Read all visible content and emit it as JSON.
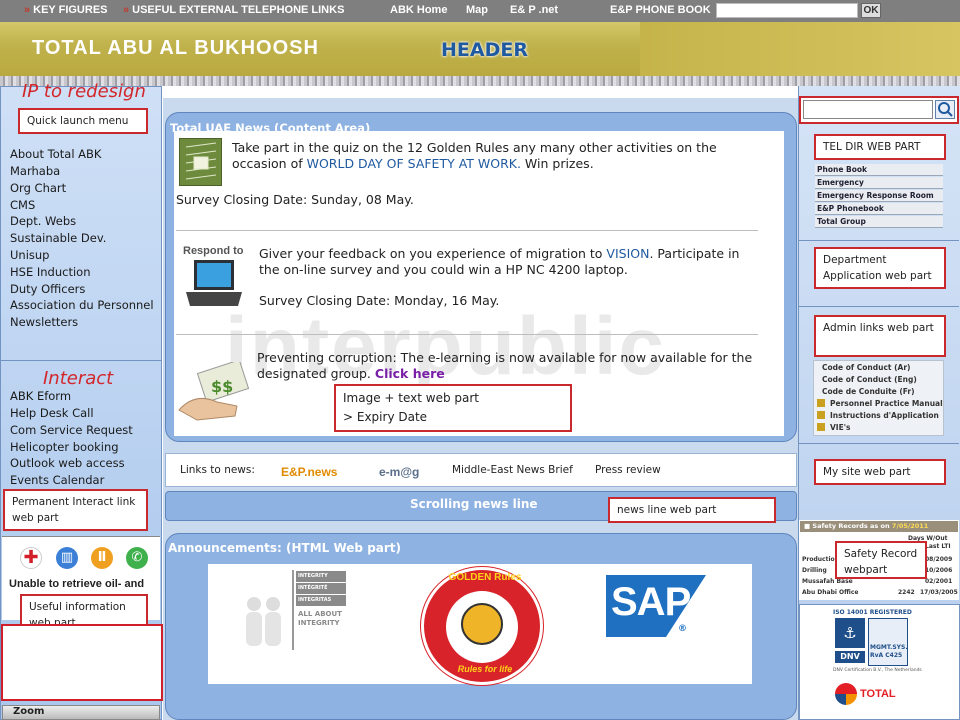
{
  "topnav": {
    "items": [
      "KEY FIGURES",
      "USEFUL EXTERNAL TELEPHONE LINKS",
      "ABK Home",
      "Map",
      "E& P .net",
      "E&P PHONE BOOK"
    ],
    "ok_label": "OK"
  },
  "header": {
    "brand": "TOTAL ABU AL BUKHOOSH",
    "label": "HEADER"
  },
  "annotations": {
    "ip_redesign": "IP to redesign",
    "quick_launch": "Quick launch menu",
    "interact_title": "Interact",
    "permanent_interact": "Permanent Interact link web part",
    "useful_info": "Useful information web part",
    "image_text": [
      "Image + text web part",
      "> Expiry Date"
    ],
    "news_line": "news line web part",
    "tel_dir": "TEL DIR WEB PART",
    "dept_app": "Department Application web part",
    "admin_links": "Admin links web part",
    "my_site": "My site web part",
    "safety_record": "Safety Record webpart"
  },
  "left_menu": {
    "quick_links": [
      "About Total ABK",
      "Marhaba",
      "Org Chart",
      "CMS",
      "Dept. Webs",
      "Sustainable Dev.",
      "Unisup",
      "HSE Induction",
      "Duty Officers",
      "Association du Personnel",
      "Newsletters"
    ],
    "interact_links": [
      "ABK Eform",
      "Help Desk Call",
      "Com Service Request",
      "Helicopter booking",
      "Outlook web access",
      "Events Calendar"
    ],
    "unable_text": "Unable to retrieve oil- and",
    "zoom": "Zoom"
  },
  "news": {
    "title": "Total UAE News (Content Area)",
    "item1": {
      "text_a": "Take part in the quiz on the 12 Golden Rules any many other activities on the occasion of ",
      "link": "WORLD DAY OF SAFETY AT WORK.",
      "text_b": " Win prizes.",
      "closing": "Survey Closing Date: Sunday, 08 May."
    },
    "item2": {
      "respond": "Respond to",
      "text_a": "Giver your feedback on you experience of migration to ",
      "link": "VISION",
      "text_b": ". Participate in the on-line survey and you could win a HP NC 4200 laptop.",
      "closing": "Survey Closing Date: Monday, 16 May."
    },
    "item3": {
      "text": "Preventing corruption: The e-learning is now available for now available for the designated group.",
      "click": "Click here"
    },
    "watermark": "interpublic"
  },
  "links_bar": {
    "label": "Links to news:",
    "enews": "E&P.news",
    "emag": "e-m@g",
    "brief": "Middle-East News Brief",
    "press": "Press review"
  },
  "scrolling": {
    "title": "Scrolling news line"
  },
  "announcements": {
    "title": "Announcements: (HTML Web part)",
    "integrity": [
      "INTEGRITY",
      "INTÉGRITÉ",
      "INTEGRITAS",
      "ALL ABOUT INTEGRITY"
    ],
    "golden_rules": [
      "GOLDEN Rules",
      "Rules for life"
    ],
    "sap": "SAP"
  },
  "right": {
    "phonebook": [
      "Phone Book",
      "Emergency",
      "Emergency Response Room",
      "E&P Phonebook",
      "Total Group"
    ],
    "admin": [
      "Code of Conduct (Ar)",
      "Code of Conduct (Eng)",
      "Code de Conduite (Fr)",
      "Personnel Practice Manual",
      "Instructions d'Application",
      "VIE's"
    ],
    "safety": {
      "title": "Safety Records as on",
      "date": "7/05/2011",
      "cols": [
        "Days W/Out",
        "Last LTI"
      ],
      "rows": [
        [
          "Production",
          "",
          "08/2009"
        ],
        [
          "Drilling",
          "",
          "10/2006"
        ],
        [
          "Mussafah Base",
          "",
          "02/2001"
        ],
        [
          "Abu Dhabi Office",
          "2242",
          "17/03/2005"
        ]
      ]
    },
    "iso": [
      "ISO 14001 REGISTERED",
      "DNV",
      "MGMT.SYS. RvA C425",
      "DNV Certification B.V., The Netherlands"
    ],
    "total": "TOTAL"
  },
  "colors": {
    "accent_red": "#c9282d",
    "panel_blue": "#8eb2e2",
    "link_blue": "#1f5aa0",
    "header_gold": "#c0b24c"
  }
}
